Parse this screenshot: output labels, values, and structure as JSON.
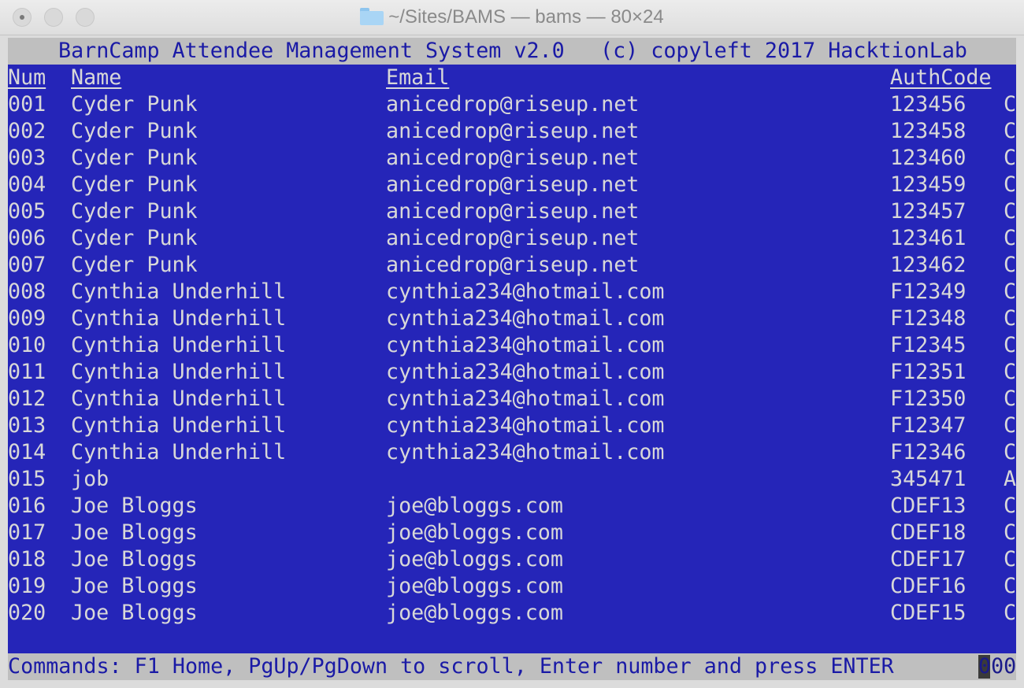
{
  "window": {
    "title": "~/Sites/BAMS — bams — 80×24"
  },
  "terminal": {
    "header_left": "BarnCamp Attendee Management System v2.0",
    "header_right": "(c) copyleft 2017 HacktionLab",
    "columns": {
      "num": "Num",
      "name": "Name",
      "email": "Email",
      "auth": "AuthCode"
    },
    "rows": [
      {
        "num": "001",
        "name": "Cyder Punk",
        "email": "anicedrop@riseup.net",
        "auth": "123456",
        "extra": "C"
      },
      {
        "num": "002",
        "name": "Cyder Punk",
        "email": "anicedrop@riseup.net",
        "auth": "123458",
        "extra": "C"
      },
      {
        "num": "003",
        "name": "Cyder Punk",
        "email": "anicedrop@riseup.net",
        "auth": "123460",
        "extra": "C"
      },
      {
        "num": "004",
        "name": "Cyder Punk",
        "email": "anicedrop@riseup.net",
        "auth": "123459",
        "extra": "C"
      },
      {
        "num": "005",
        "name": "Cyder Punk",
        "email": "anicedrop@riseup.net",
        "auth": "123457",
        "extra": "C"
      },
      {
        "num": "006",
        "name": "Cyder Punk",
        "email": "anicedrop@riseup.net",
        "auth": "123461",
        "extra": "C"
      },
      {
        "num": "007",
        "name": "Cyder Punk",
        "email": "anicedrop@riseup.net",
        "auth": "123462",
        "extra": "C"
      },
      {
        "num": "008",
        "name": "Cynthia Underhill",
        "email": "cynthia234@hotmail.com",
        "auth": "F12349",
        "extra": "C"
      },
      {
        "num": "009",
        "name": "Cynthia Underhill",
        "email": "cynthia234@hotmail.com",
        "auth": "F12348",
        "extra": "C"
      },
      {
        "num": "010",
        "name": "Cynthia Underhill",
        "email": "cynthia234@hotmail.com",
        "auth": "F12345",
        "extra": "C"
      },
      {
        "num": "011",
        "name": "Cynthia Underhill",
        "email": "cynthia234@hotmail.com",
        "auth": "F12351",
        "extra": "C"
      },
      {
        "num": "012",
        "name": "Cynthia Underhill",
        "email": "cynthia234@hotmail.com",
        "auth": "F12350",
        "extra": "C"
      },
      {
        "num": "013",
        "name": "Cynthia Underhill",
        "email": "cynthia234@hotmail.com",
        "auth": "F12347",
        "extra": "C"
      },
      {
        "num": "014",
        "name": "Cynthia Underhill",
        "email": "cynthia234@hotmail.com",
        "auth": "F12346",
        "extra": "C"
      },
      {
        "num": "015",
        "name": "job",
        "email": "",
        "auth": "345471",
        "extra": "A"
      },
      {
        "num": "016",
        "name": "Joe Bloggs",
        "email": "joe@bloggs.com",
        "auth": "CDEF13",
        "extra": "C"
      },
      {
        "num": "017",
        "name": "Joe Bloggs",
        "email": "joe@bloggs.com",
        "auth": "CDEF18",
        "extra": "C"
      },
      {
        "num": "018",
        "name": "Joe Bloggs",
        "email": "joe@bloggs.com",
        "auth": "CDEF17",
        "extra": "C"
      },
      {
        "num": "019",
        "name": "Joe Bloggs",
        "email": "joe@bloggs.com",
        "auth": "CDEF16",
        "extra": "C"
      },
      {
        "num": "020",
        "name": "Joe Bloggs",
        "email": "joe@bloggs.com",
        "auth": "CDEF15",
        "extra": "C"
      }
    ],
    "commands": "Commands: F1 Home, PgUp/PgDown to scroll, Enter number and press ENTER",
    "input_value": "000"
  },
  "colors": {
    "terminal_bg": "#2525b8",
    "bar_bg": "#bfbfbf",
    "bar_text": "#1a1aa6",
    "text": "#d8d8d8"
  }
}
